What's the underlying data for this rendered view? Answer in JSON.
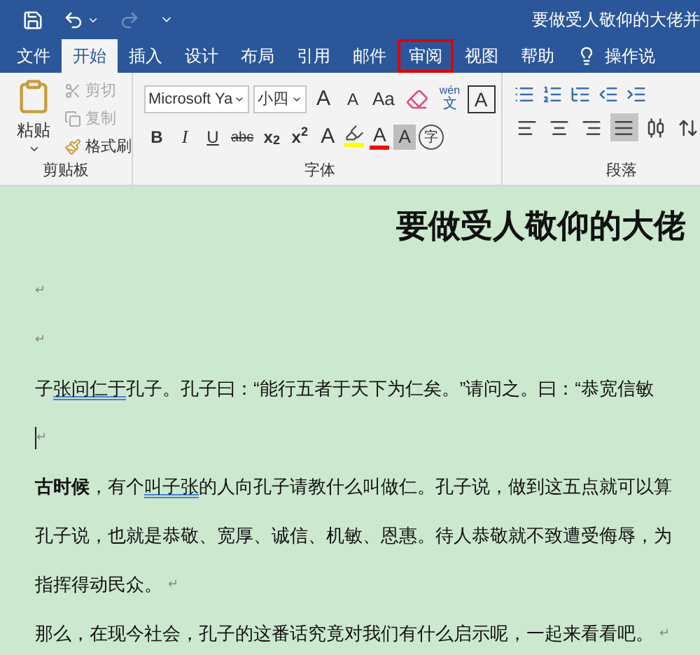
{
  "title_bar": {
    "title": "要做受人敬仰的大佬并",
    "redo_disabled": true
  },
  "tabs": [
    {
      "label": "文件",
      "selected": false,
      "annotated": false
    },
    {
      "label": "开始",
      "selected": true,
      "annotated": false
    },
    {
      "label": "插入",
      "selected": false,
      "annotated": false
    },
    {
      "label": "设计",
      "selected": false,
      "annotated": false
    },
    {
      "label": "布局",
      "selected": false,
      "annotated": false
    },
    {
      "label": "引用",
      "selected": false,
      "annotated": false
    },
    {
      "label": "邮件",
      "selected": false,
      "annotated": false
    },
    {
      "label": "审阅",
      "selected": false,
      "annotated": true
    },
    {
      "label": "视图",
      "selected": false,
      "annotated": false
    },
    {
      "label": "帮助",
      "selected": false,
      "annotated": false
    }
  ],
  "tell_me": {
    "label": "操作说"
  },
  "clipboard": {
    "paste": "粘贴",
    "items": [
      {
        "kind": "cut",
        "label": "剪切",
        "disabled": true
      },
      {
        "kind": "copy",
        "label": "复制",
        "disabled": true
      },
      {
        "kind": "painter",
        "label": "格式刷",
        "disabled": false
      }
    ],
    "group_label": "剪贴板"
  },
  "font": {
    "font_name": "Microsoft Ya",
    "font_size": "小四",
    "row1": [
      {
        "kind": "grow",
        "label": "A"
      },
      {
        "kind": "shrink",
        "label": "A"
      },
      {
        "kind": "case",
        "label": "Aa"
      },
      {
        "kind": "clear"
      },
      {
        "kind": "phonetic",
        "ruby": "wén",
        "label": "文"
      },
      {
        "kind": "border",
        "label": "A"
      }
    ],
    "row2": [
      {
        "kind": "bold",
        "label": "B"
      },
      {
        "kind": "italic",
        "label": "I"
      },
      {
        "kind": "underline",
        "label": "U"
      },
      {
        "kind": "strike",
        "label": "abc"
      },
      {
        "kind": "script",
        "label": "x$_{2}$"
      },
      {
        "kind": "script",
        "label": "x$^{2}$"
      },
      {
        "kind": "effects",
        "label": "A"
      },
      {
        "kind": "highlight",
        "color": "#ffff00"
      },
      {
        "kind": "font_color",
        "label": "A",
        "color": "#ff0000"
      },
      {
        "kind": "shading",
        "label": "A"
      },
      {
        "kind": "enclose",
        "label": "字"
      }
    ],
    "group_label": "字体"
  },
  "paragraph": {
    "row1": [
      {
        "kind": "bullets"
      },
      {
        "kind": "numbering"
      },
      {
        "kind": "multilevel"
      },
      {
        "kind": "outdent"
      },
      {
        "kind": "indent"
      }
    ],
    "row2": [
      {
        "kind": "left",
        "selected": false
      },
      {
        "kind": "center",
        "selected": false
      },
      {
        "kind": "right",
        "selected": false
      },
      {
        "kind": "justify",
        "selected": true
      },
      {
        "kind": "distributed",
        "selected": false
      },
      {
        "kind": "spacing",
        "selected": false
      }
    ],
    "group_label": "段落"
  },
  "document": {
    "title": "要做受人敬仰的大佬",
    "lines": [
      {
        "kind": "empty",
        "mark": "↵"
      },
      {
        "kind": "empty",
        "mark": "↵"
      },
      {
        "kind": "text",
        "runs": [
          {
            "text": "子",
            "flagged": false,
            "bold": false
          },
          {
            "text": "张问仁于",
            "flagged": true,
            "bold": false
          },
          {
            "text": "孔子。孔子曰：“能行五者于天下为仁矣。”请问之。曰：“恭宽信敏",
            "flagged": false,
            "bold": false
          }
        ]
      },
      {
        "kind": "cursor",
        "mark": "↵"
      },
      {
        "kind": "text",
        "runs": [
          {
            "text": "古时候",
            "flagged": false,
            "bold": true
          },
          {
            "text": "，有个",
            "flagged": false,
            "bold": false
          },
          {
            "text": "叫子张",
            "flagged": true,
            "bold": false
          },
          {
            "text": "的人向孔子请教什么叫做仁。孔子说，做到这五点就可以算",
            "flagged": false,
            "bold": false
          }
        ]
      },
      {
        "kind": "text",
        "runs": [
          {
            "text": "孔子说，也就是恭敬、宽厚、诚信、机敏、恩惠。待人恭敬就不致遭受侮辱，为",
            "flagged": false,
            "bold": false
          }
        ]
      },
      {
        "kind": "text",
        "runs": [
          {
            "text": "指挥得动民众。",
            "flagged": false,
            "bold": false
          }
        ],
        "mark": "↵"
      },
      {
        "kind": "text",
        "runs": [
          {
            "text": "那么，在现今社会，孔子的这番话究竟对我们有什么启示呢，一起来看看吧。",
            "flagged": false,
            "bold": false
          }
        ],
        "mark": "↵"
      }
    ]
  }
}
